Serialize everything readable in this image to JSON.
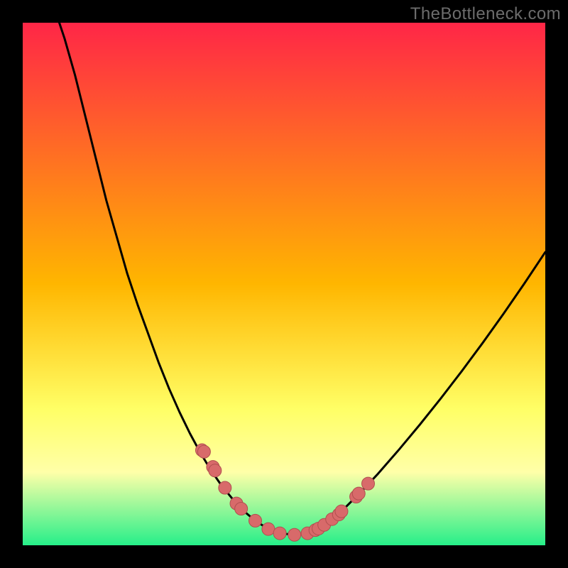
{
  "watermark": "TheBottleneck.com",
  "colors": {
    "frame_bg": "#000000",
    "gradient_top": "#ff2647",
    "gradient_mid1": "#ffb600",
    "gradient_mid2": "#ffff66",
    "gradient_band": "#ffffa8",
    "gradient_bottom": "#26ef89",
    "curve": "#000000",
    "marker_fill": "#d86a6a",
    "marker_stroke": "#b04f4f"
  },
  "chart_data": {
    "type": "line",
    "title": "",
    "xlabel": "",
    "ylabel": "",
    "xlim": [
      0,
      1
    ],
    "ylim": [
      0,
      1
    ],
    "series": [
      {
        "name": "bottleneck-curve",
        "x": [
          0.07,
          0.08,
          0.1,
          0.12,
          0.14,
          0.16,
          0.18,
          0.2,
          0.22,
          0.24,
          0.26,
          0.28,
          0.3,
          0.32,
          0.34,
          0.36,
          0.38,
          0.402,
          0.42,
          0.445,
          0.47,
          0.492,
          0.52,
          0.545,
          0.56,
          0.577,
          0.6,
          0.62,
          0.65,
          0.68,
          0.72,
          0.76,
          0.8,
          0.84,
          0.88,
          0.92,
          0.96,
          1.0
        ],
        "y": [
          1.0,
          0.97,
          0.9,
          0.82,
          0.74,
          0.66,
          0.59,
          0.52,
          0.46,
          0.405,
          0.35,
          0.3,
          0.255,
          0.214,
          0.177,
          0.144,
          0.115,
          0.088,
          0.068,
          0.047,
          0.031,
          0.023,
          0.02,
          0.023,
          0.029,
          0.039,
          0.056,
          0.075,
          0.105,
          0.137,
          0.183,
          0.231,
          0.281,
          0.333,
          0.387,
          0.443,
          0.501,
          0.561
        ]
      }
    ],
    "markers": {
      "name": "highlighted-points",
      "x": [
        0.343,
        0.347,
        0.364,
        0.368,
        0.387,
        0.409,
        0.418,
        0.445,
        0.47,
        0.492,
        0.52,
        0.545,
        0.56,
        0.566,
        0.577,
        0.592,
        0.605,
        0.61,
        0.638,
        0.643,
        0.661
      ],
      "y": [
        0.182,
        0.179,
        0.15,
        0.143,
        0.11,
        0.08,
        0.07,
        0.047,
        0.031,
        0.023,
        0.02,
        0.023,
        0.029,
        0.032,
        0.039,
        0.05,
        0.059,
        0.065,
        0.093,
        0.099,
        0.118
      ]
    }
  }
}
